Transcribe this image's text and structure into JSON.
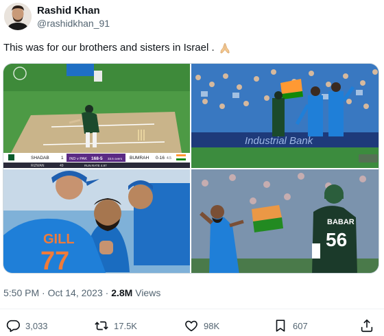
{
  "author": {
    "display_name": "Rashid Khan",
    "handle": "@rashidkhan_91",
    "avatar_icon": "avatar-photo"
  },
  "tweet": {
    "text": "This was for our brothers and sisters in Israel .",
    "emoji_icon": "folded-hands-icon"
  },
  "media": {
    "scoreboard": {
      "team1": "SHADAB",
      "team1_sub": "RIZWAN",
      "team1_score": "1",
      "team1_sub_score": "49",
      "match": "IND v PAK",
      "score": "168-5",
      "overs": "33.5 overs",
      "run_rate": "RUN RATE 4.97",
      "bowler": "BUMRAH",
      "bowler_figures": "0-16",
      "bowler_overs": "4.5"
    },
    "ad_board_text": "Industrial Bank",
    "jersey_left_name": "GILL",
    "jersey_left_number": "77",
    "jersey_right_name": "BABAR",
    "jersey_right_number": "56",
    "colors": {
      "india_blue": "#1f7fd8",
      "pakistan_green": "#1b3a2a",
      "pitch": "#c9b48a",
      "grass": "#3f8f3c"
    }
  },
  "meta": {
    "time": "5:50 PM",
    "separator": "·",
    "date": "Oct 14, 2023",
    "views_count": "2.8M",
    "views_label": "Views"
  },
  "actions": {
    "reply": {
      "icon": "reply-icon",
      "count": "3,033"
    },
    "repost": {
      "icon": "repost-icon",
      "count": "17.5K"
    },
    "like": {
      "icon": "heart-icon",
      "count": "98K"
    },
    "bookmark": {
      "icon": "bookmark-icon",
      "count": "607"
    },
    "share": {
      "icon": "share-icon"
    }
  }
}
